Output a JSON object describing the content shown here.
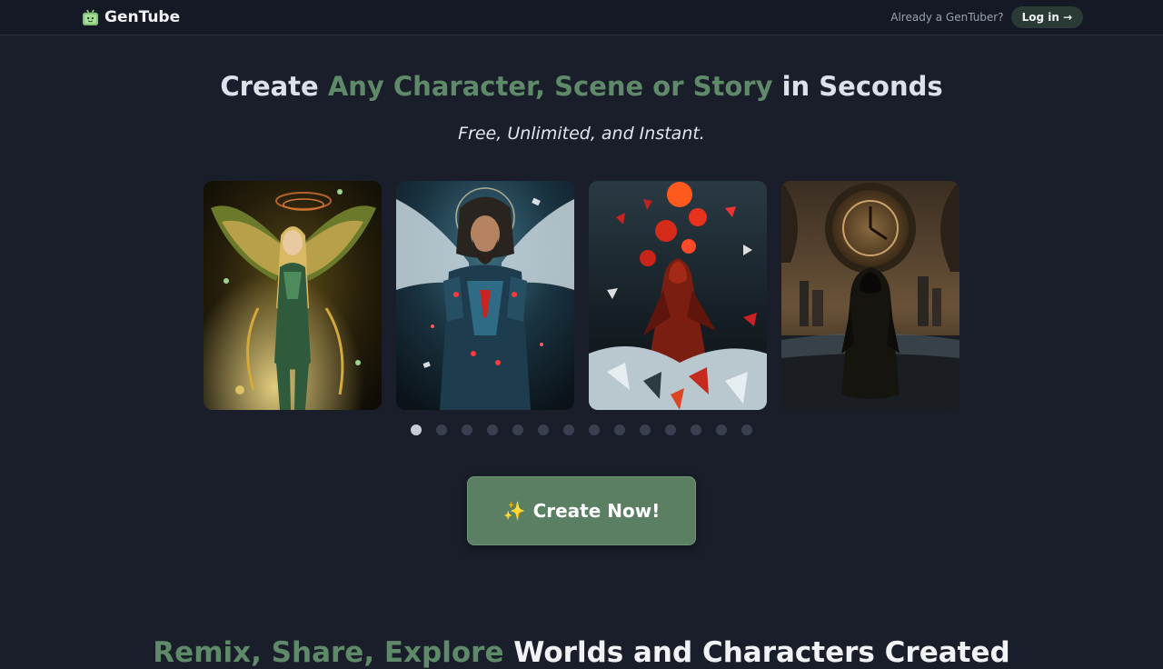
{
  "header": {
    "brand": "GenTube",
    "already_text": "Already a GenTuber?",
    "login_label": "Log in",
    "login_arrow": "→"
  },
  "hero": {
    "title_pre": "Create ",
    "title_accent": "Any Character, Scene or Story",
    "title_post": " in Seconds",
    "subtitle": "Free, Unlimited, and Instant."
  },
  "carousel": {
    "slides": [
      {
        "image": "winged-angel-woman"
      },
      {
        "image": "winged-armored-man"
      },
      {
        "image": "hooded-figure-shards"
      },
      {
        "image": "hooded-figure-clock"
      }
    ],
    "dot_count": 14,
    "active_index": 0
  },
  "cta": {
    "icon": "sparkles-icon",
    "label": "Create Now!"
  },
  "section": {
    "title_accent": "Remix, Share, Explore",
    "title_rest": " Worlds and Characters Created"
  },
  "colors": {
    "background": "#1a1e2a",
    "accent": "#5f8a69",
    "button": "#5a7f62"
  }
}
